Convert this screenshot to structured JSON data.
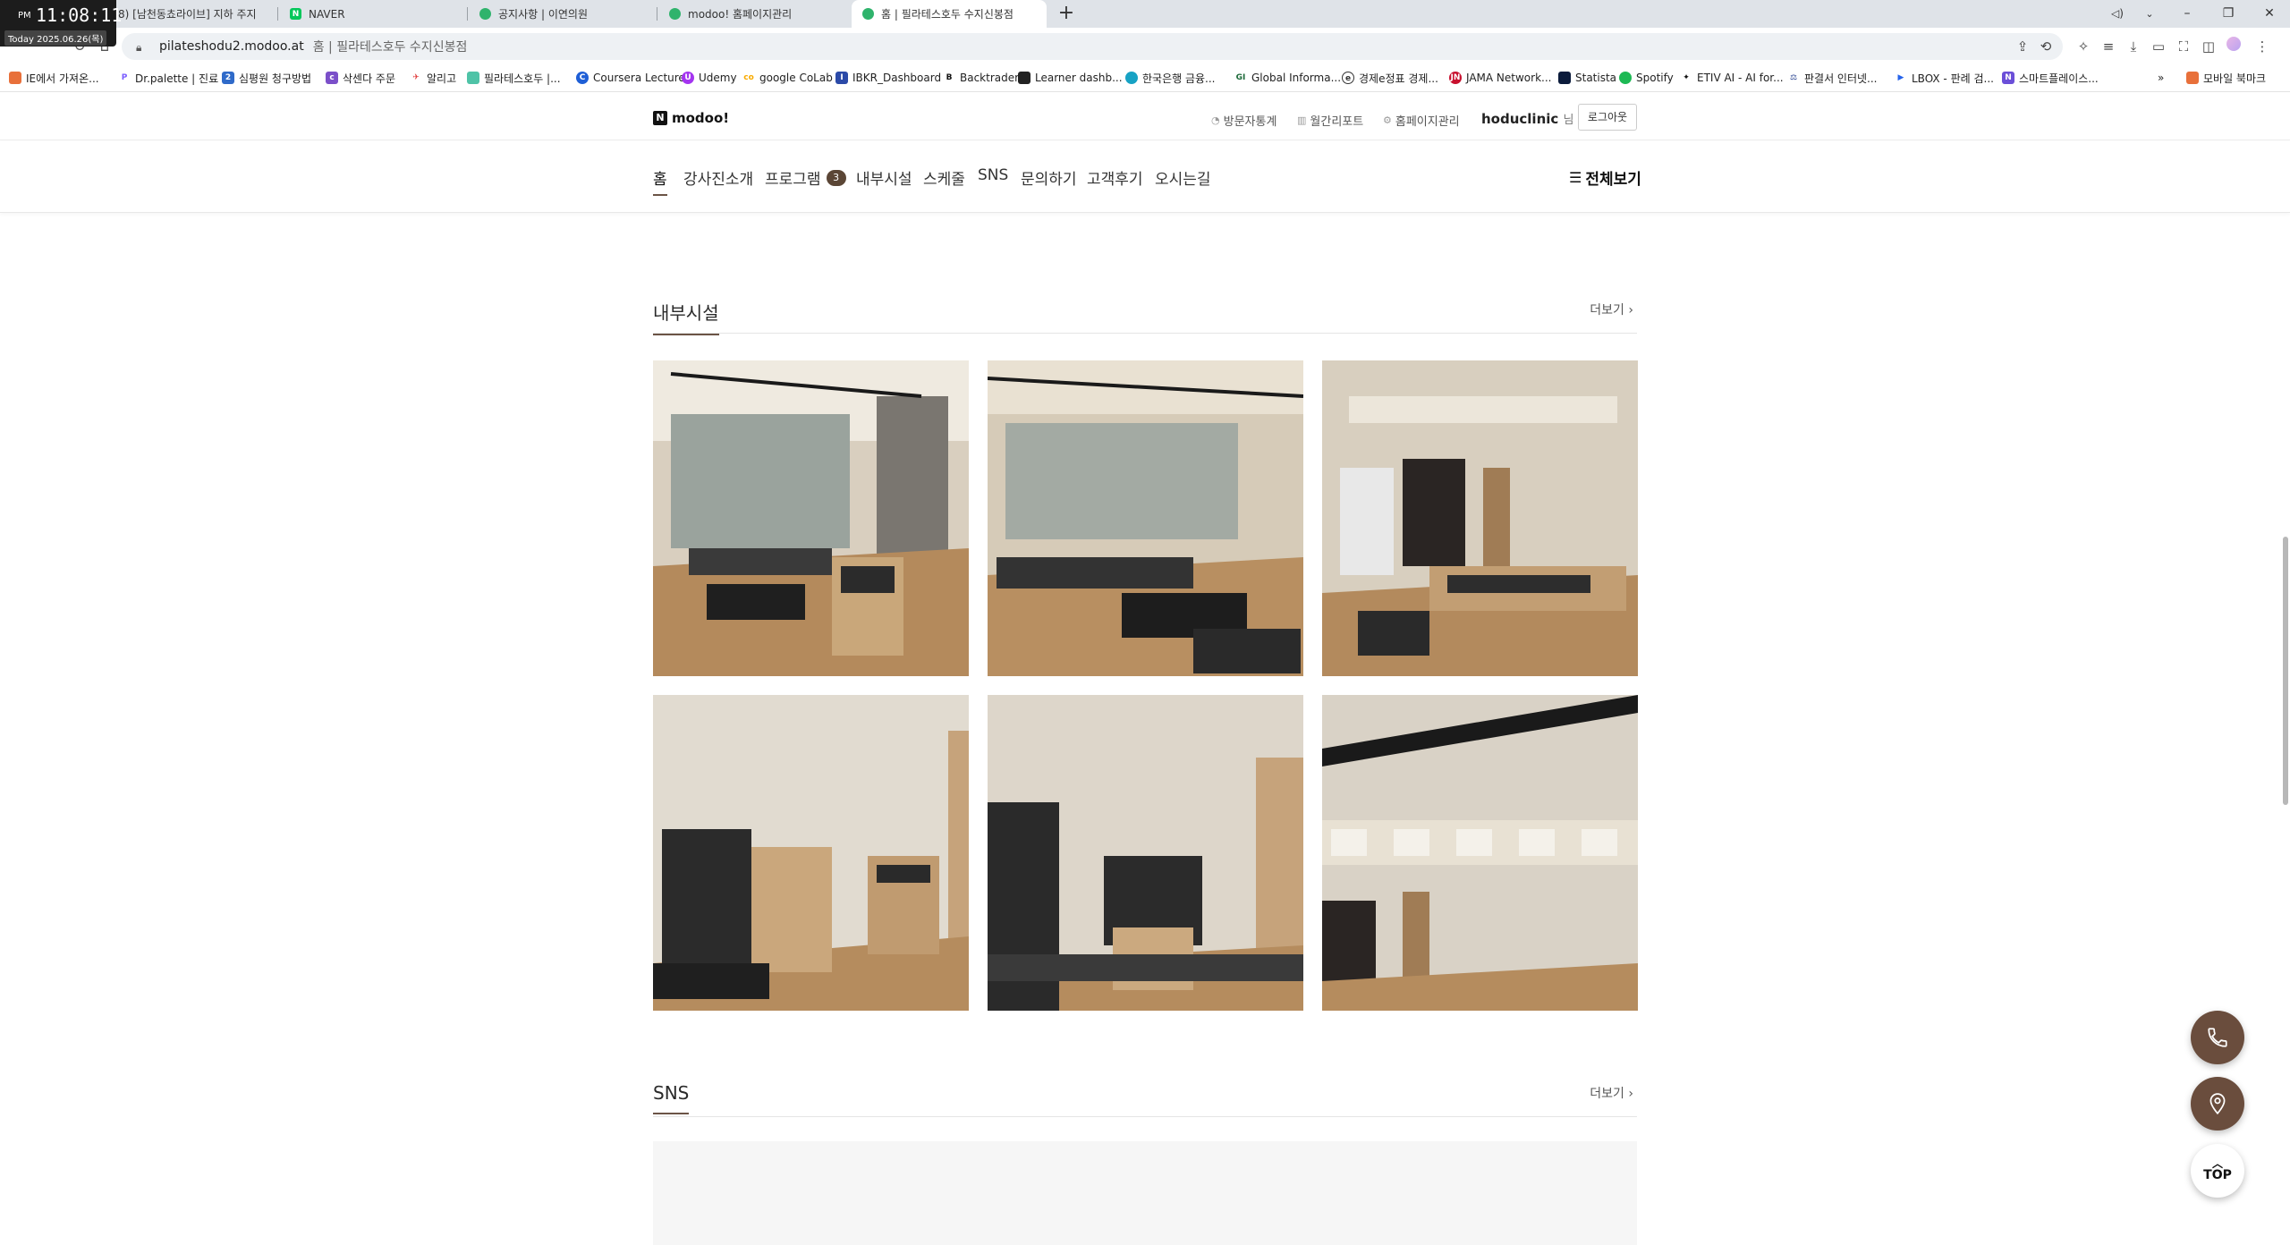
{
  "clock": {
    "ampm": "PM",
    "time": "11:08:11",
    "date": "Today 2025.06.26(목)"
  },
  "tabs": [
    {
      "label": "8) [남천동쵸라이브] 지하 주지",
      "active": false
    },
    {
      "label": "NAVER",
      "active": false
    },
    {
      "label": "공지사항 | 이연의원",
      "active": false
    },
    {
      "label": "modoo! 홈페이지관리",
      "active": false
    },
    {
      "label": "홈 | 필라테스호두 수지신봉점",
      "active": true
    }
  ],
  "address": {
    "host": "pilateshodu2.modoo.at",
    "title": "홈 | 필라테스호두 수지신봉점"
  },
  "bookmarks": [
    "IE에서 가져온...",
    "Dr.palette | 진료",
    "심평원 청구방법",
    "삭센다 주문",
    "알리고",
    "필라테스호두 |...",
    "Coursera Lecture",
    "Udemy",
    "google CoLab",
    "IBKR_Dashboard",
    "Backtrader",
    "Learner dashb...",
    "한국은행 금융...",
    "Global Informa...",
    "경제e정표 경제...",
    "JAMA Network...",
    "Statista",
    "Spotify",
    "ETIV AI - AI for...",
    "판결서 인터넷...",
    "LBOX - 판례 검...",
    "스마트플레이스..."
  ],
  "bookmark_overflow": "»",
  "mobile_bookmarks": "모바일 북마크",
  "site": {
    "logo": "modoo!",
    "util_links": [
      "방문자통계",
      "월간리포트",
      "홈페이지관리"
    ],
    "user": "hoduclinic",
    "user_suffix": "님",
    "logout": "로그아웃"
  },
  "nav": {
    "items": [
      "홈",
      "강사진소개",
      "프로그램",
      "내부시설",
      "스케줄",
      "SNS",
      "문의하기",
      "고객후기",
      "오시는길"
    ],
    "program_badge": "3",
    "view_all": "전체보기"
  },
  "sections": {
    "facility_title": "내부시설",
    "facility_more": "더보기",
    "sns_title": "SNS",
    "sns_more": "더보기"
  },
  "fab": {
    "top_label": "TOP"
  },
  "colors": {
    "accent": "#6b5446",
    "fab": "#6a4d3d"
  }
}
